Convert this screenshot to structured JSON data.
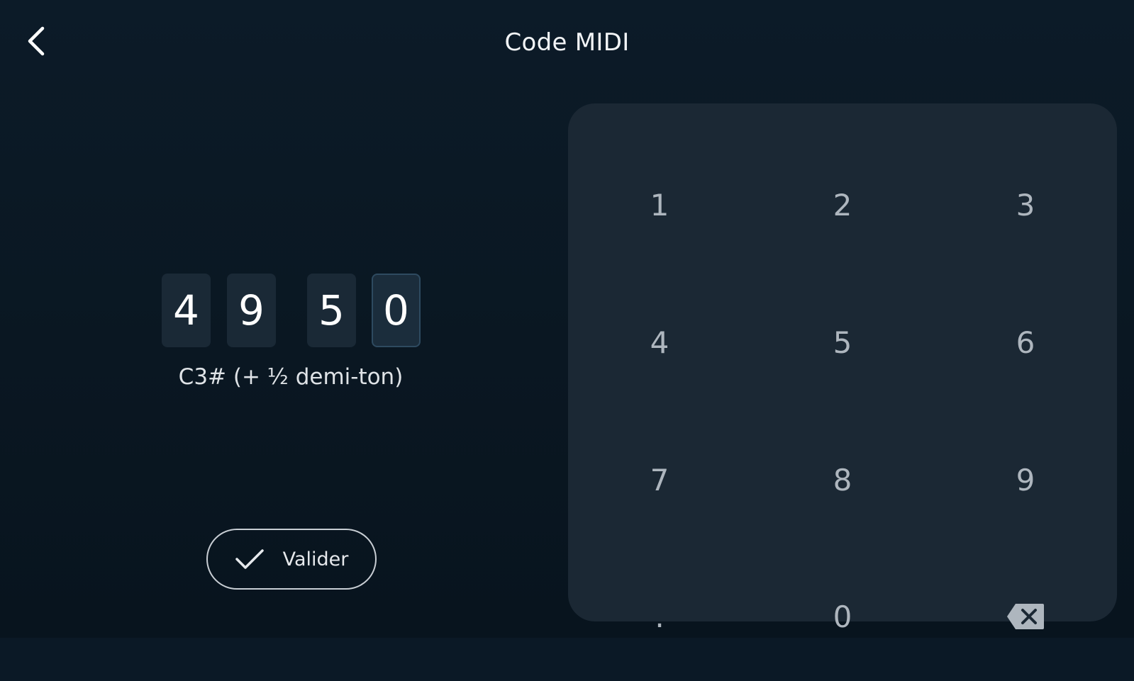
{
  "header": {
    "title": "Code MIDI",
    "back_icon": "chevron-left-icon"
  },
  "entry": {
    "digits": [
      "4",
      "9",
      "5",
      "0"
    ],
    "active_index": 3,
    "note_label": "C3# (+ ½ demi-ton)"
  },
  "validate": {
    "label": "Valider",
    "icon": "check-icon"
  },
  "keypad": {
    "keys": [
      "1",
      "2",
      "3",
      "4",
      "5",
      "6",
      "7",
      "8",
      "9",
      ".",
      "0"
    ],
    "backspace_icon": "backspace-icon"
  },
  "colors": {
    "background": "#0b1926",
    "keypad_panel": "#1b2834",
    "digit_box": "#1a2936",
    "key_text": "#aeb6be"
  }
}
